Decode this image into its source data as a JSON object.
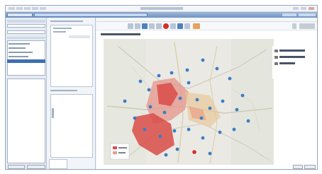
{
  "app": {
    "window_title": "",
    "menu_items": [
      "",
      "",
      "",
      "",
      "",
      ""
    ]
  },
  "tabs": [
    {
      "label": ""
    },
    {
      "label": ""
    }
  ],
  "left_panel": {
    "fields": [
      "",
      ""
    ],
    "list_items": [
      "",
      "",
      "",
      "",
      ""
    ],
    "selected_index": 4
  },
  "middle_panel": {
    "sections": [
      "",
      "",
      ""
    ]
  },
  "map_view": {
    "title": "",
    "legend_items": [
      {
        "label": "",
        "color": "#ffffff"
      },
      {
        "label": "",
        "color": "#ffffff"
      },
      {
        "label": "",
        "color": "#ffffff"
      }
    ],
    "icon_color": "#3b7dc4",
    "heat_color": "#d94c48"
  },
  "colors": {
    "titlebar": "#6f93c4",
    "accent": "#3d6fb3",
    "map_land": "#ebe9e4"
  },
  "buttons": {
    "bottom_left_1": "",
    "bottom_left_2": "",
    "bottom_right_1": "",
    "bottom_right_2": ""
  },
  "status_text": ""
}
